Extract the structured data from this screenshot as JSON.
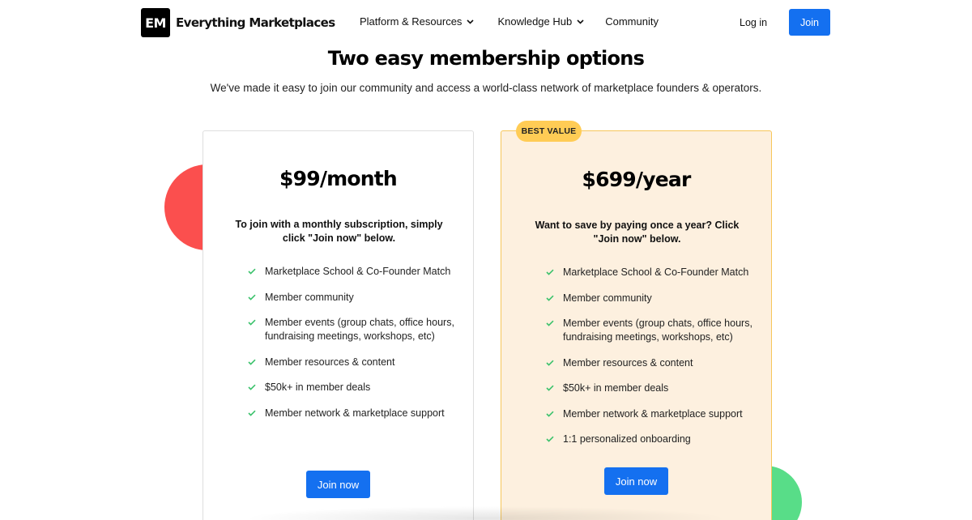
{
  "brand": {
    "logo_mark": "EM",
    "name": "Everything Marketplaces"
  },
  "nav": {
    "items": [
      {
        "label": "Platform & Resources",
        "has_dropdown": true
      },
      {
        "label": "Knowledge Hub",
        "has_dropdown": true
      },
      {
        "label": "Community",
        "has_dropdown": false
      }
    ],
    "login_label": "Log in",
    "join_label": "Join"
  },
  "hero": {
    "title": "Two easy membership options",
    "subtitle": "We've made it easy to join our community and access a world-class network of marketplace founders & operators."
  },
  "plans": [
    {
      "price": "$99/month",
      "description": "To join with a monthly subscription, simply click \"Join now\" below.",
      "features": [
        "Marketplace School & Co-Founder Match",
        "Member community",
        "Member events (group chats, office hours, fundraising meetings, workshops, etc)",
        "Member resources & content",
        "$50k+ in member deals",
        "Member network & marketplace support"
      ],
      "cta_label": "Join now"
    },
    {
      "badge": "BEST VALUE",
      "price": "$699/year",
      "description": "Want to save by paying once a year? Click \"Join now\" below.",
      "features": [
        "Marketplace School & Co-Founder Match",
        "Member community",
        "Member events (group chats, office hours, fundraising meetings, workshops, etc)",
        "Member resources & content",
        "$50k+ in member deals",
        "Member network & marketplace support",
        "1:1 personalized onboarding"
      ],
      "cta_label": "Join now"
    }
  ],
  "colors": {
    "accent": "#1470f0",
    "badge": "#ffcc55",
    "highlight_card_bg": "#fdf0df",
    "highlight_card_border": "#f7c65a",
    "decor_red": "#fb4f4e",
    "decor_green": "#58dd88",
    "check": "#3cc26c"
  }
}
